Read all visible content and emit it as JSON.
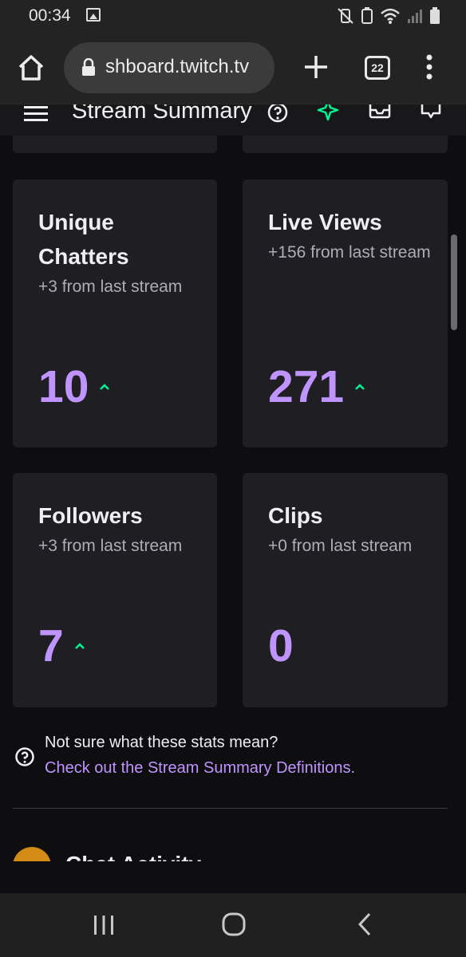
{
  "status_bar": {
    "time": "00:34"
  },
  "browser": {
    "url": "shboard.twitch.tv",
    "tab_count": "22"
  },
  "header": {
    "title": "Stream Summary"
  },
  "cards": [
    {
      "title": "Unique Chatters",
      "subtitle": "+3 from last stream",
      "value": "10",
      "trend": "up"
    },
    {
      "title": "Live Views",
      "subtitle": "+156 from last stream",
      "value": "271",
      "trend": "up"
    },
    {
      "title": "Followers",
      "subtitle": "+3 from last stream",
      "value": "7",
      "trend": "up"
    },
    {
      "title": "Clips",
      "subtitle": "+0 from last stream",
      "value": "0",
      "trend": "none"
    }
  ],
  "help": {
    "question": "Not sure what these stats mean?",
    "link": "Check out the Stream Summary Definitions."
  },
  "next_section": {
    "title": "Chat Activity"
  },
  "colors": {
    "accent": "#bf94ff",
    "trend_up": "#00f593",
    "card_bg": "#1f1f23",
    "page_bg": "#0e0e10"
  }
}
